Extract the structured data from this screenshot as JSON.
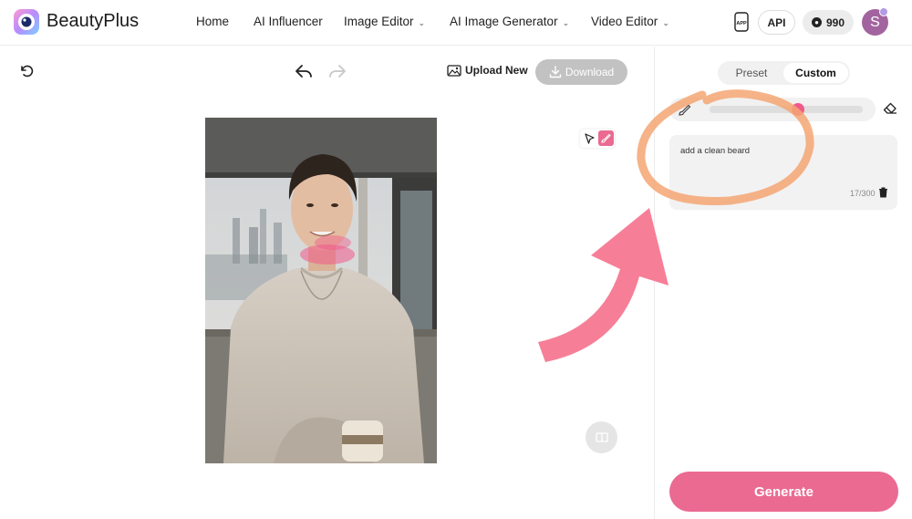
{
  "header": {
    "brand": "BeautyPlus",
    "nav": [
      {
        "label": "Home",
        "has_dropdown": false
      },
      {
        "label": "AI Influencer",
        "has_dropdown": false
      },
      {
        "label": "Image Editor",
        "has_dropdown": true
      },
      {
        "label": "AI Image Generator",
        "has_dropdown": true
      },
      {
        "label": "Video Editor",
        "has_dropdown": true
      }
    ],
    "app_icon": "APP",
    "api_label": "API",
    "credits": "990",
    "avatar_initial": "S"
  },
  "toolbar": {
    "upload_label": "Upload New",
    "download_label": "Download"
  },
  "panel": {
    "tabs": [
      {
        "label": "Preset",
        "active": false
      },
      {
        "label": "Custom",
        "active": true
      }
    ],
    "brush_size": 0.58,
    "prompt_text": "add a clean beard",
    "char_count": "17/300",
    "generate_label": "Generate"
  },
  "colors": {
    "accent": "#ea6a92",
    "mask": "#f05a8a",
    "annotation_circle": "#f5a673",
    "annotation_arrow": "#f57891"
  }
}
